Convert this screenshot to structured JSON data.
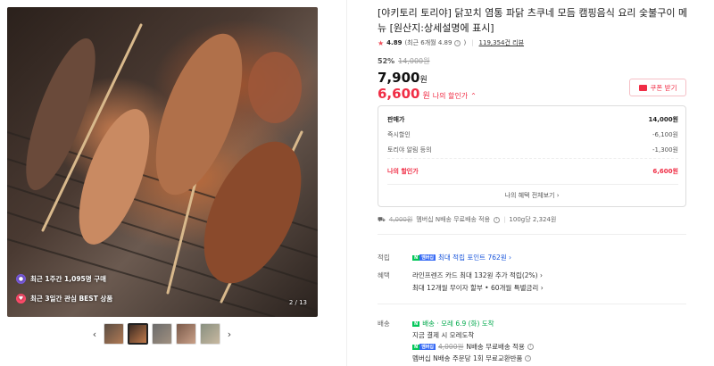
{
  "gallery": {
    "badge1": "최근 1주간 1,095명 구매",
    "badge2": "최근 3일간 관심 BEST 상품",
    "counter": "2 / 13",
    "prev_arrow": "‹",
    "next_arrow": "›"
  },
  "product": {
    "title": "[야키토리 토리야] 닭꼬치 염통 파닭 츠쿠네 모듬 캠핑음식 요리 숯불구이 메뉴 [원산지:상세설명에 표시]",
    "rating_score": "4.89",
    "rating_note": "(최근 6개월 4.89",
    "review_count": "119,354건 리뷰",
    "discount_pct": "52%",
    "original_price": "14,000원",
    "sale_price": "7,900",
    "sale_unit": "원",
    "my_price": "6,600",
    "my_unit": "원",
    "my_price_label": "나의 할인가",
    "coupon_label": "쿠폰 받기"
  },
  "pricebox": {
    "rows": [
      {
        "label": "판매가",
        "value": "14,000원"
      },
      {
        "label": "즉시할인",
        "value": "-6,100원"
      },
      {
        "label": "토리야 알림 등의",
        "value": "-1,300원"
      },
      {
        "label": "나의 할인가",
        "value": "6,600원"
      }
    ],
    "more_label": "나의 혜택 전체보기 ›"
  },
  "shipping_summary": {
    "strike": "4,000원",
    "text": "멤버십 N배송 무료배송 적용",
    "unit_price": "100g당 2,324원"
  },
  "sections": {
    "points_label": "적립",
    "points_text": "최대 적립 포인트 762원 ›",
    "benefit_label": "혜택",
    "benefit_line1": "라인프렌즈 카드 최대 132원 추가 적립(2%) ›",
    "benefit_line2": "최대 12개월 무이자 할부 • 60개월 특별금리 ›",
    "delivery_label": "배송",
    "delivery_line1": "배송 · 모레 6.9 (화) 도착",
    "delivery_line2": "지금 결제 시 모레도착",
    "delivery_line3_strike": "4,000원",
    "delivery_line3": "N배송 무료배송 적용",
    "delivery_line4": "멤버십 N배송 주문당 1회 무료교환반품"
  },
  "colors": {
    "accent_red": "#f02e46",
    "npay_green": "#03c75a",
    "link_blue": "#1a56db"
  }
}
